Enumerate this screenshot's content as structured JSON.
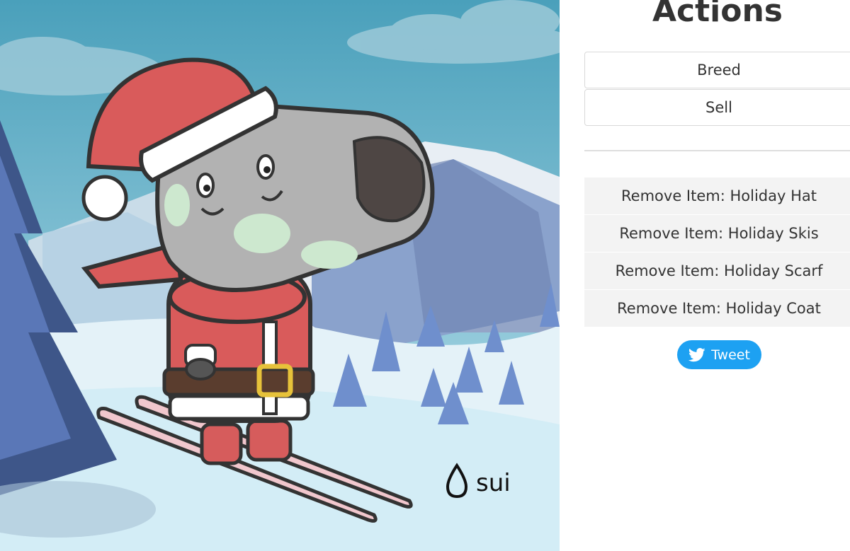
{
  "actions": {
    "title": "Actions",
    "breed_label": "Breed",
    "sell_label": "Sell"
  },
  "remove_items": [
    {
      "label": "Remove Item: Holiday Hat"
    },
    {
      "label": "Remove Item: Holiday Skis"
    },
    {
      "label": "Remove Item: Holiday Scarf"
    },
    {
      "label": "Remove Item: Holiday Coat"
    }
  ],
  "tweet": {
    "label": "Tweet",
    "icon": "twitter-bird-icon",
    "color": "#1da1f2"
  },
  "artwork": {
    "watermark": "sui",
    "watermark_icon": "sui-droplet-icon",
    "items_worn": [
      "Holiday Hat",
      "Holiday Skis",
      "Holiday Scarf",
      "Holiday Coat"
    ]
  }
}
